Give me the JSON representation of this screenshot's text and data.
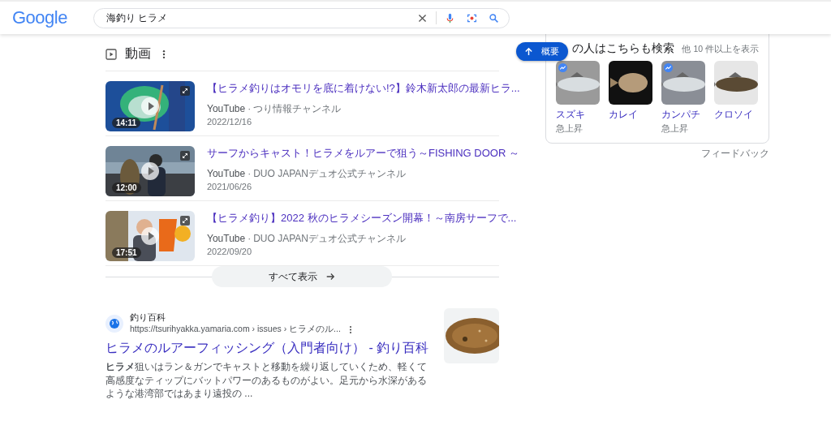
{
  "header": {
    "logo": "Google",
    "search": {
      "value": "海釣り ヒラメ"
    }
  },
  "videos": {
    "title": "動画",
    "items": [
      {
        "title": "【ヒラメ釣りはオモリを底に着けない!?】鈴木新太郎の最新ヒラ...",
        "source": "YouTube",
        "channel": "つり情報チャンネル",
        "date": "2022/12/16",
        "duration": "14:11",
        "kind": "picture"
      },
      {
        "title": "サーフからキャスト！ヒラメをルアーで狙う～FISHING DOOR ～",
        "source": "YouTube",
        "channel": "DUO JAPANデュオ公式チャンネル",
        "date": "2021/06/26",
        "duration": "12:00",
        "kind": "picture"
      },
      {
        "title": "【ヒラメ釣り】2022 秋のヒラメシーズン開幕！～南房サーフで...",
        "source": "YouTube",
        "channel": "DUO JAPANデュオ公式チャンネル",
        "date": "2022/09/20",
        "duration": "17:51",
        "kind": "picture"
      }
    ],
    "separator": "·",
    "show_all": "すべて表示"
  },
  "result": {
    "site": "釣り百科",
    "url": "https://tsurihyakka.yamaria.com › issues › ヒラメのル...",
    "title": "ヒラメのルアーフィッシング（入門者向け） - 釣り百科",
    "snippet": "**ヒラメ**狙いはラン＆ガンでキャストと移動を繰り返していくため、軽くて高感度なティップにバットパワーのあるものがよい。足元から水深があるような港湾部ではあまり遠投の ..."
  },
  "overview_button": "概要",
  "related": {
    "title": "の人はこちらも検索",
    "more": "他 10 件以上を表示",
    "items": [
      {
        "name": "スズキ",
        "trending": true,
        "note": "急上昇"
      },
      {
        "name": "カレイ",
        "trending": false
      },
      {
        "name": "カンパチ",
        "trending": true,
        "note": "急上昇"
      },
      {
        "name": "クロソイ",
        "trending": false
      }
    ],
    "feedback": "フィードバック"
  }
}
